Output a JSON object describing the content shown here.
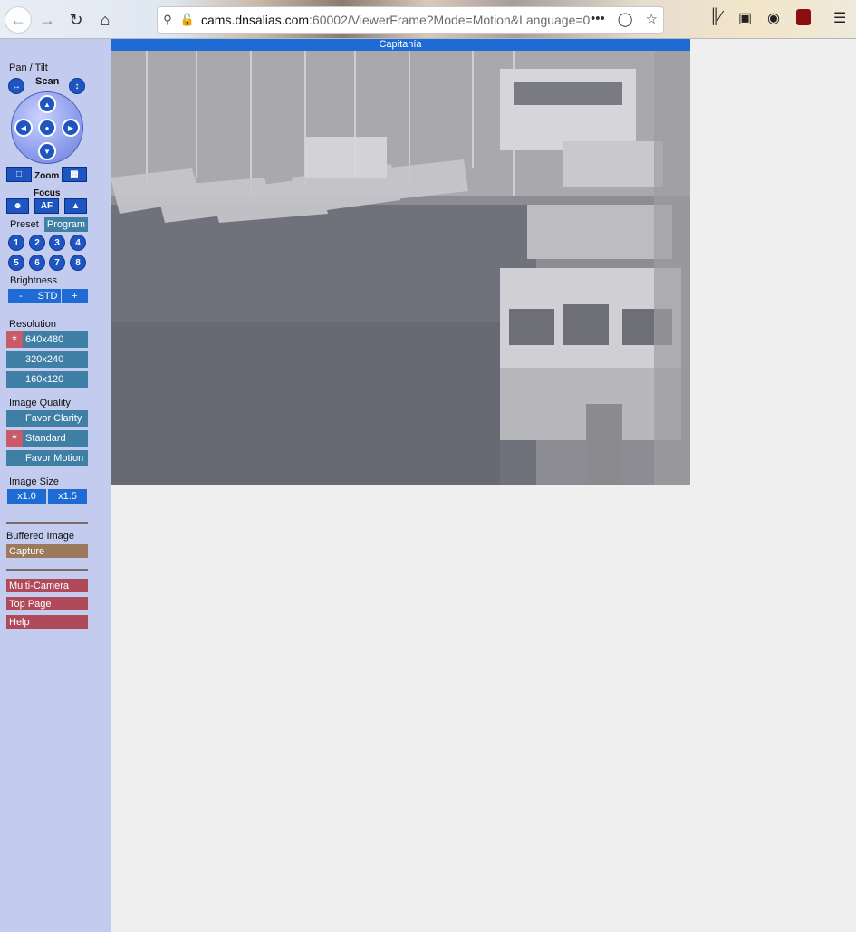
{
  "browser": {
    "url_host": "cams.dnsalias.com",
    "url_rest": ":60002/ViewerFrame?Mode=Motion&Language=0",
    "more_glyph": "•••"
  },
  "camera": {
    "title": "Capitanía"
  },
  "panel": {
    "pan_tilt_label": "Pan / Tilt",
    "scan_label": "Scan",
    "zoom_label": "Zoom",
    "focus_label": "Focus",
    "af_label": "AF",
    "preset_label": "Preset",
    "program_label": "Program",
    "presets": [
      "1",
      "2",
      "3",
      "4",
      "5",
      "6",
      "7",
      "8"
    ],
    "brightness_label": "Brightness",
    "brightness_minus": "-",
    "brightness_std": "STD",
    "brightness_plus": "+",
    "resolution_label": "Resolution",
    "resolutions": [
      "640x480",
      "320x240",
      "160x120"
    ],
    "resolution_selected_marker": "*",
    "image_quality_label": "Image Quality",
    "qualities": [
      "Favor Clarity",
      "Standard",
      "Favor Motion"
    ],
    "quality_selected_marker": "*",
    "image_size_label": "Image Size",
    "size_1": "x1.0",
    "size_2": "x1.5",
    "buffered_label": "Buffered Image",
    "capture_label": "Capture",
    "links": [
      "Multi-Camera",
      "Top Page",
      "Help"
    ]
  }
}
